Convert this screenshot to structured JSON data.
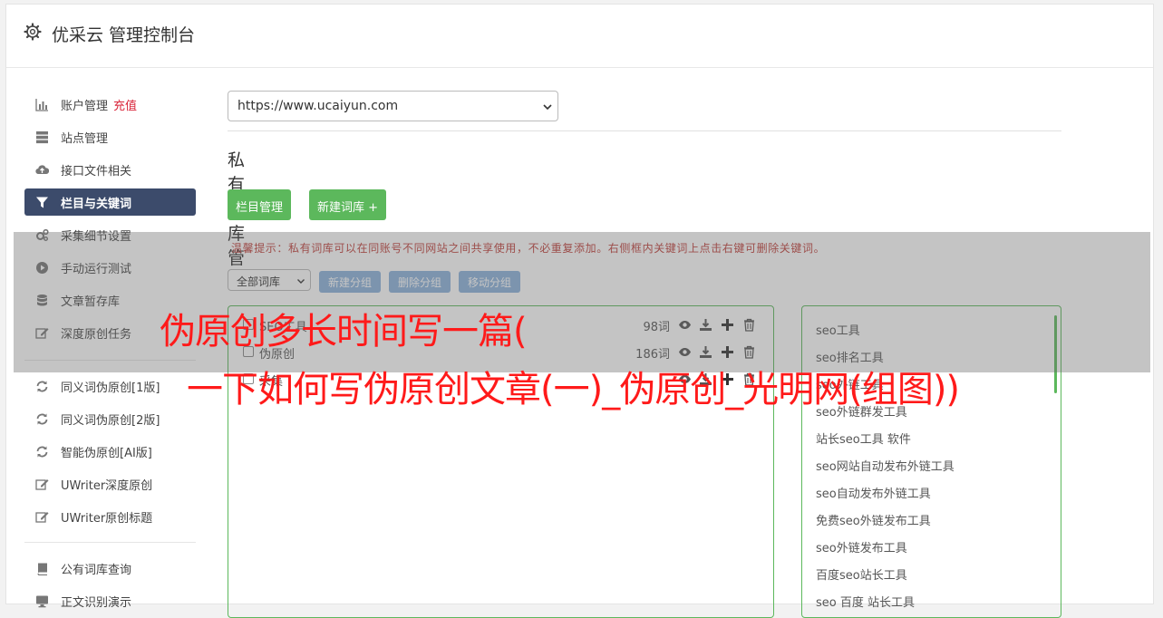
{
  "header": {
    "title": "优采云 管理控制台",
    "icon": "gear-icon"
  },
  "sidebar": {
    "items": [
      {
        "label": "账户管理",
        "badge": "充值",
        "icon": "bar-chart-icon"
      },
      {
        "label": "站点管理",
        "icon": "server-icon"
      },
      {
        "label": "接口文件相关",
        "icon": "cloud-upload-icon"
      },
      {
        "label": "栏目与关键词",
        "icon": "filter-icon",
        "active": true
      },
      {
        "label": "采集细节设置",
        "icon": "gears-icon"
      },
      {
        "label": "手动运行测试",
        "icon": "play-circle-icon"
      },
      {
        "label": "文章暂存库",
        "icon": "database-icon"
      },
      {
        "label": "深度原创任务",
        "icon": "edit-icon"
      },
      {
        "label": "同义词伪原创[1版]",
        "icon": "refresh-icon"
      },
      {
        "label": "同义词伪原创[2版]",
        "icon": "refresh-icon"
      },
      {
        "label": "智能伪原创[AI版]",
        "icon": "refresh-icon"
      },
      {
        "label": "UWriter深度原创",
        "icon": "edit-icon"
      },
      {
        "label": "UWriter原创标题",
        "icon": "edit-icon"
      },
      {
        "label": "公有词库查询",
        "icon": "book-icon"
      },
      {
        "label": "正文识别演示",
        "icon": "monitor-icon"
      }
    ]
  },
  "main": {
    "site_select": {
      "value": "https://www.ucaiyun.com"
    },
    "section_title": "私有词库管理",
    "buttons": {
      "column_manage": "栏目管理",
      "new_library": "新建词库 +"
    },
    "tip": "温馨提示：私有词库可以在同账号不同网站之间共享使用，不必重复添加。右侧框内关键词上点击右键可删除关键词。",
    "library_select": {
      "value": "全部词库"
    },
    "group_buttons": {
      "new_group": "新建分组",
      "delete_group": "删除分组",
      "move_group": "移动分组"
    },
    "libraries": [
      {
        "name": "SEO工具",
        "count": "98词"
      },
      {
        "name": "伪原创",
        "count": "186词"
      },
      {
        "name": "采集",
        "count": ""
      }
    ],
    "keywords": [
      "seo工具",
      "seo排名工具",
      "seo外链工具",
      "seo外链群发工具",
      "站长seo工具 软件",
      "seo网站自动发布外链工具",
      "seo自动发布外链工具",
      "免费seo外链发布工具",
      "seo外链发布工具",
      "百度seo站长工具",
      "seo 百度 站长工具"
    ]
  },
  "overlay": {
    "headline_line1": "伪原创多长时间写一篇(",
    "headline_line2": "一下如何写伪原创文章(一)_伪原创_光明网(组图))",
    "headline_color": "#ff1a1a"
  },
  "colors": {
    "primary": "#5cb85c",
    "active_nav": "#3c4b6b",
    "secondary_button": "#8cb2dc",
    "recharge": "#d9263b"
  }
}
